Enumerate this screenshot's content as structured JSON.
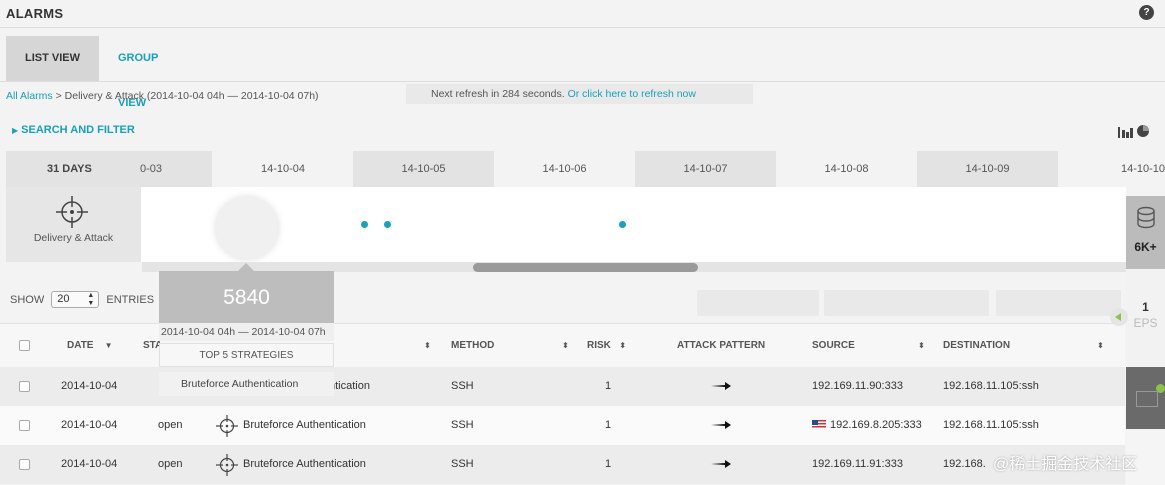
{
  "header": {
    "title": "ALARMS",
    "help": "?"
  },
  "tabs": {
    "list": "LIST VIEW",
    "group": "GROUP VIEW"
  },
  "breadcrumb": {
    "root": "All Alarms",
    "rest": " > Delivery & Attack (2014-10-04 04h — 2014-10-04 07h)"
  },
  "refresh": {
    "text": "Next refresh in 284 seconds.",
    "link": "Or click here to refresh now"
  },
  "search_filter": "SEARCH AND FILTER",
  "timeline": {
    "range_label": "31 DAYS",
    "days": [
      "0-03",
      "14-10-04",
      "14-10-05",
      "14-10-06",
      "14-10-07",
      "14-10-08",
      "14-10-09",
      "14-10-10"
    ]
  },
  "category": {
    "label": "Delivery & Attack"
  },
  "popup": {
    "count": "5840",
    "range": "2014-10-04 04h — 2014-10-04 07h",
    "strategies_label": "TOP 5 STRATEGIES",
    "item": "Bruteforce Authentication"
  },
  "entries": {
    "show": "SHOW",
    "value": "20",
    "suffix": "ENTRIES"
  },
  "columns": {
    "date": "DATE",
    "status": "STA",
    "method": "METHOD",
    "risk": "RISK",
    "attack_pattern": "ATTACK PATTERN",
    "source": "SOURCE",
    "destination": "DESTINATION"
  },
  "rows": [
    {
      "date": "2014-10-04",
      "status": "",
      "strategy": "ntication",
      "method": "SSH",
      "risk": "1",
      "source": "192.169.11.90:333",
      "destination": "192.168.11.105:ssh"
    },
    {
      "date": "2014-10-04",
      "status": "open",
      "strategy": "Bruteforce Authentication",
      "method": "SSH",
      "risk": "1",
      "source": "192.169.8.205:333",
      "destination": "192.168.11.105:ssh"
    },
    {
      "date": "2014-10-04",
      "status": "open",
      "strategy": "Bruteforce Authentication",
      "method": "SSH",
      "risk": "1",
      "source": "192.169.11.91:333",
      "destination": "192.168."
    }
  ],
  "side_panel": {
    "events": "6K+",
    "eps_value": "1",
    "eps_label": "EPS"
  },
  "watermark": "@稀土掘金技术社区",
  "colors": {
    "accent": "#1aa0b8",
    "active_tab": "#d6d6d6",
    "popup": "#bdbdbd"
  }
}
